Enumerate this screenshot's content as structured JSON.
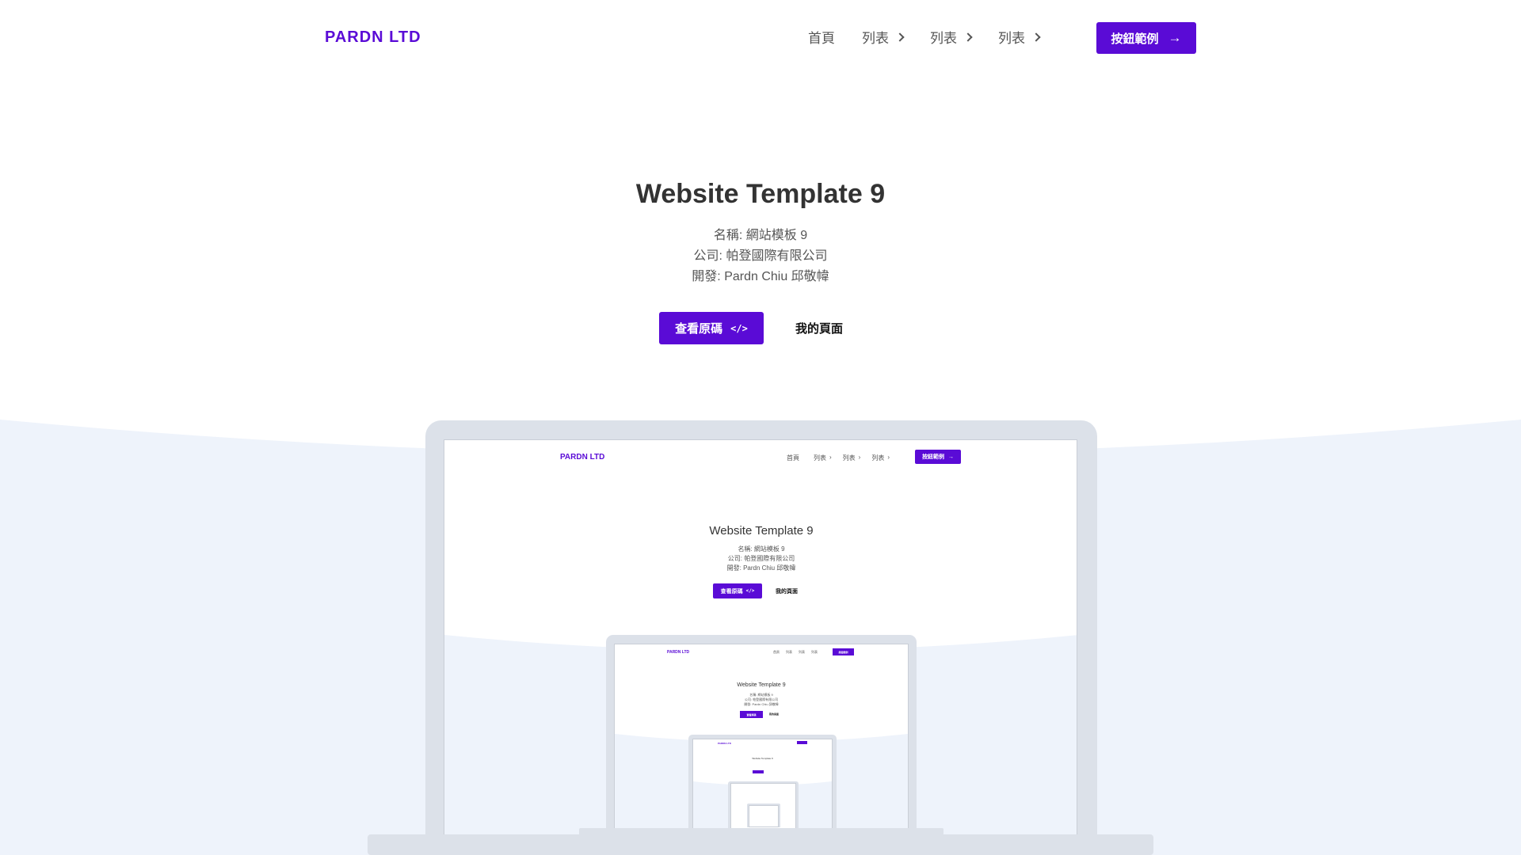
{
  "nav": {
    "brand": "PARDN LTD",
    "links": [
      {
        "label": "首頁",
        "has_chevron": false
      },
      {
        "label": "列表",
        "has_chevron": true
      },
      {
        "label": "列表",
        "has_chevron": true
      },
      {
        "label": "列表",
        "has_chevron": true
      }
    ],
    "cta_label": "按鈕範例",
    "cta_icon": "arrow-right-icon"
  },
  "hero": {
    "title": "Website Template 9",
    "meta": [
      "名稱: 網站模板 9",
      "公司: 帕登國際有限公司",
      "開發: Pardn Chiu 邱敬幃"
    ],
    "primary_label": "查看原碼",
    "primary_icon": "code-icon",
    "secondary_label": "我的頁面"
  },
  "colors": {
    "accent": "#5a0bd6",
    "curve_bg": "#eef3fb",
    "device": "#dce1e9"
  }
}
